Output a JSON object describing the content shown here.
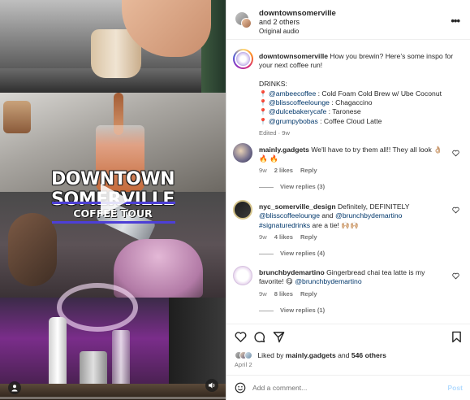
{
  "video": {
    "title_main": "DOWNTOWN SOMERVILLE",
    "title_sub": "COFFEE TOUR",
    "progress_fraction": 0.0
  },
  "header": {
    "username": "downtownsomerville",
    "coauthors": "and 2 others",
    "audio": "Original audio"
  },
  "caption": {
    "username": "downtownsomerville",
    "text_line1": "How you brewin? Here’s some inspo for your next coffee run!",
    "drinks_heading": "DRINKS:",
    "drinks": [
      {
        "handle": "@ambeecoffee",
        "drink": ": Cold Foam Cold Brew w/ Ube Coconut"
      },
      {
        "handle": "@blisscoffeelounge",
        "drink": ": Chagaccino"
      },
      {
        "handle": "@dulcebakerycafe",
        "drink": ": Taronese"
      },
      {
        "handle": "@grumpybobas",
        "drink": ": Coffee Cloud Latte"
      }
    ],
    "meta": "Edited · 9w"
  },
  "comments": [
    {
      "username": "mainly.gadgets",
      "text": "We'll have to try them all!! They all look 👌🏼",
      "text2": "🔥 🔥",
      "age": "9w",
      "likes": "2 likes",
      "reply": "Reply",
      "view_replies": "View replies (3)"
    },
    {
      "username": "nyc_somerville_design",
      "text_a": "Definitely, DEFINITELY",
      "mention1": "@blisscoffeelounge",
      "and": "and",
      "mention2": "@brunchbydemartino",
      "tag": "#signaturedrinks",
      "text_b": "are a tie! 🙌🏼🙌🏼",
      "age": "9w",
      "likes": "4 likes",
      "reply": "Reply",
      "view_replies": "View replies (4)"
    },
    {
      "username": "brunchbydemartino",
      "text_a": "Gingerbread chai tea latte is my favorite! 😋",
      "mention": "@brunchbydemartino",
      "age": "9w",
      "likes": "8 likes",
      "reply": "Reply",
      "view_replies": "View replies (1)"
    }
  ],
  "likes": {
    "prefix": "Liked by",
    "user": "mainly.gadgets",
    "and": "and",
    "others": "546 others"
  },
  "date": "April 2",
  "add_comment": {
    "placeholder": "Add a comment...",
    "post_label": "Post"
  },
  "icons": {
    "more": "more-options-icon",
    "heart": "heart-icon",
    "comment": "comment-icon",
    "share": "share-icon",
    "save": "bookmark-icon",
    "emoji": "emoji-icon"
  }
}
